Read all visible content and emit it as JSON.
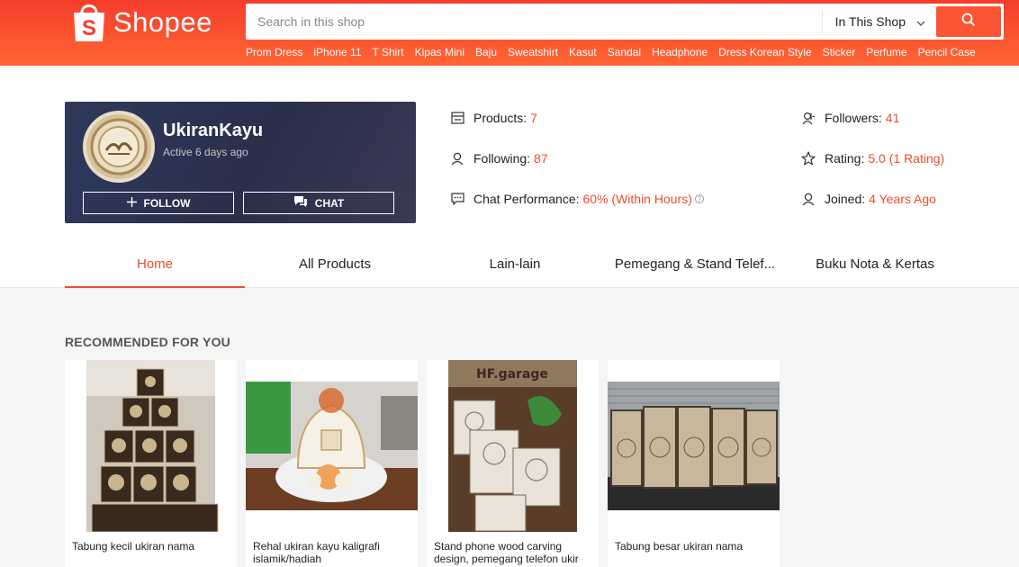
{
  "brand": {
    "name": "Shopee",
    "color": "#ee4d2d"
  },
  "search": {
    "placeholder": "Search in this shop",
    "scope": "In This Shop",
    "hints": [
      "Prom Dress",
      "iPhone 11",
      "T Shirt",
      "Kipas Mini",
      "Baju",
      "Sweatshirt",
      "Kasut",
      "Sandal",
      "Headphone",
      "Dress Korean Style",
      "Sticker",
      "Perfume",
      "Pencil Case"
    ]
  },
  "shop": {
    "name": "UkiranKayu",
    "active": "Active 6 days ago",
    "follow_label": "FOLLOW",
    "chat_label": "CHAT"
  },
  "stats": {
    "products": {
      "label": "Products:",
      "value": "7",
      "icon": "store-icon"
    },
    "following": {
      "label": "Following:",
      "value": "87",
      "icon": "person-icon"
    },
    "chat_performance": {
      "label": "Chat Performance:",
      "value": "60% (Within Hours)",
      "icon": "chat-bubble-icon"
    },
    "followers": {
      "label": "Followers:",
      "value": "41",
      "icon": "followers-icon"
    },
    "rating": {
      "label": "Rating:",
      "value": "5.0 (1 Rating)",
      "icon": "star-icon"
    },
    "joined": {
      "label": "Joined:",
      "value": "4 Years Ago",
      "icon": "person-icon"
    }
  },
  "tabs": [
    "Home",
    "All Products",
    "Lain-lain",
    "Pemegang & Stand Telef...",
    "Buku Nota & Kertas"
  ],
  "recommended": {
    "title": "RECOMMENDED FOR YOU",
    "items": [
      {
        "title": "Tabung kecil ukiran nama"
      },
      {
        "title": "Rehal ukiran kayu kaligrafi islamik/hadiah"
      },
      {
        "title": "Stand phone wood carving design, pemegang telefon ukir"
      },
      {
        "title": "Tabung besar ukiran nama"
      }
    ]
  }
}
